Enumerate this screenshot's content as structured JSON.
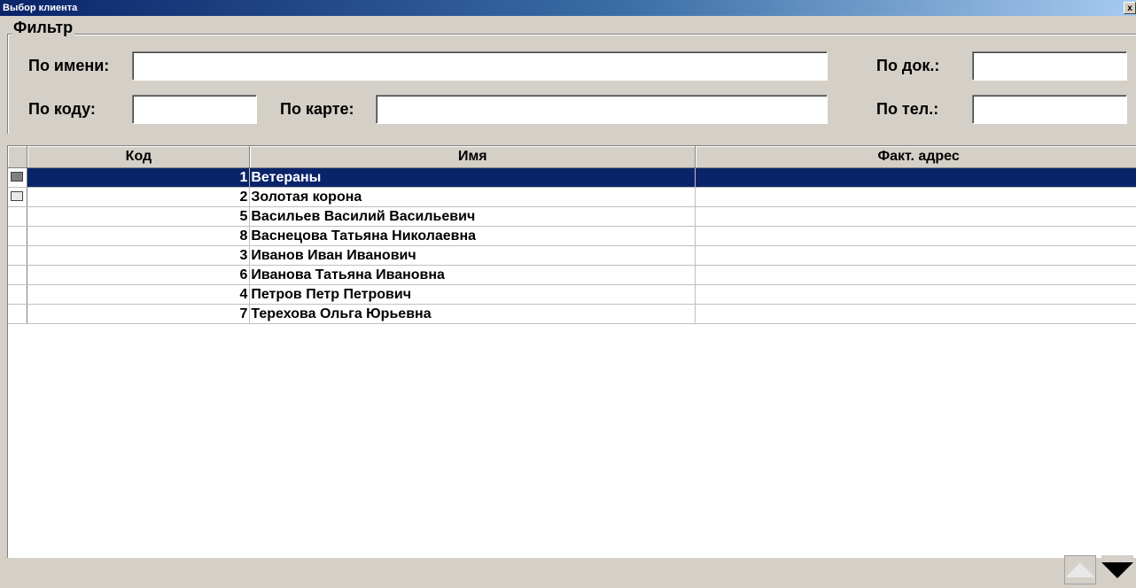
{
  "window": {
    "title": "Выбор клиента",
    "close_label": "x"
  },
  "filter": {
    "legend": "Фильтр",
    "by_name_label": "По имени:",
    "by_name_value": "",
    "by_doc_label": "По док.:",
    "by_doc_value": "",
    "by_code_label": "По коду:",
    "by_code_value": "",
    "by_card_label": "По карте:",
    "by_card_value": "",
    "by_phone_label": "По тел.:",
    "by_phone_value": ""
  },
  "grid": {
    "columns": {
      "code": "Код",
      "name": "Имя",
      "address": "Факт. адрес"
    },
    "rows": [
      {
        "code": "1",
        "name": "Ветераны",
        "address": "",
        "icon": "folder-icon"
      },
      {
        "code": "2",
        "name": "Золотая корона",
        "address": "",
        "icon": "folder-icon"
      },
      {
        "code": "5",
        "name": "Васильев Василий Васильевич",
        "address": ""
      },
      {
        "code": "8",
        "name": "Васнецова Татьяна Николаевна",
        "address": ""
      },
      {
        "code": "3",
        "name": "Иванов Иван Иванович",
        "address": ""
      },
      {
        "code": "6",
        "name": "Иванова Татьяна Ивановна",
        "address": ""
      },
      {
        "code": "4",
        "name": "Петров Петр Петрович",
        "address": ""
      },
      {
        "code": "7",
        "name": "Терехова Ольга Юрьевна",
        "address": ""
      }
    ],
    "selected_index": 0
  },
  "colors": {
    "selection": "#0a246a",
    "window_bg": "#d4d0c8"
  }
}
